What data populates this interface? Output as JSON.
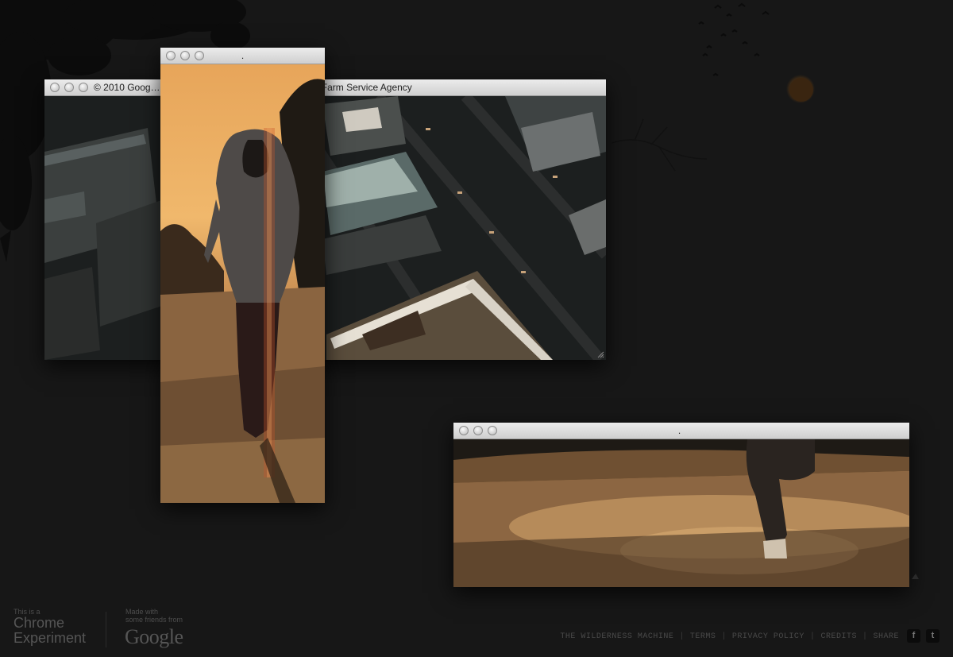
{
  "windows": {
    "aerial": {
      "title": "© 2010 Goog…es/…ological Survey, Sanborn, USDA Farm Service Agency"
    },
    "runner": {
      "title": "."
    },
    "road": {
      "title": "."
    }
  },
  "footer": {
    "experiment_small": "This is a",
    "experiment_line1": "Chrome",
    "experiment_line2": "Experiment",
    "made_with_line1": "Made with",
    "made_with_line2": "some friends from",
    "google": "Google",
    "links": [
      "THE WILDERNESS MACHINE",
      "TERMS",
      "PRIVACY POLICY",
      "CREDITS",
      "SHARE"
    ],
    "facebook_glyph": "f",
    "twitter_glyph": "t"
  },
  "icons": {
    "tree": "tree-silhouette",
    "birds": "birds-flock",
    "sun": "sun-glow"
  }
}
